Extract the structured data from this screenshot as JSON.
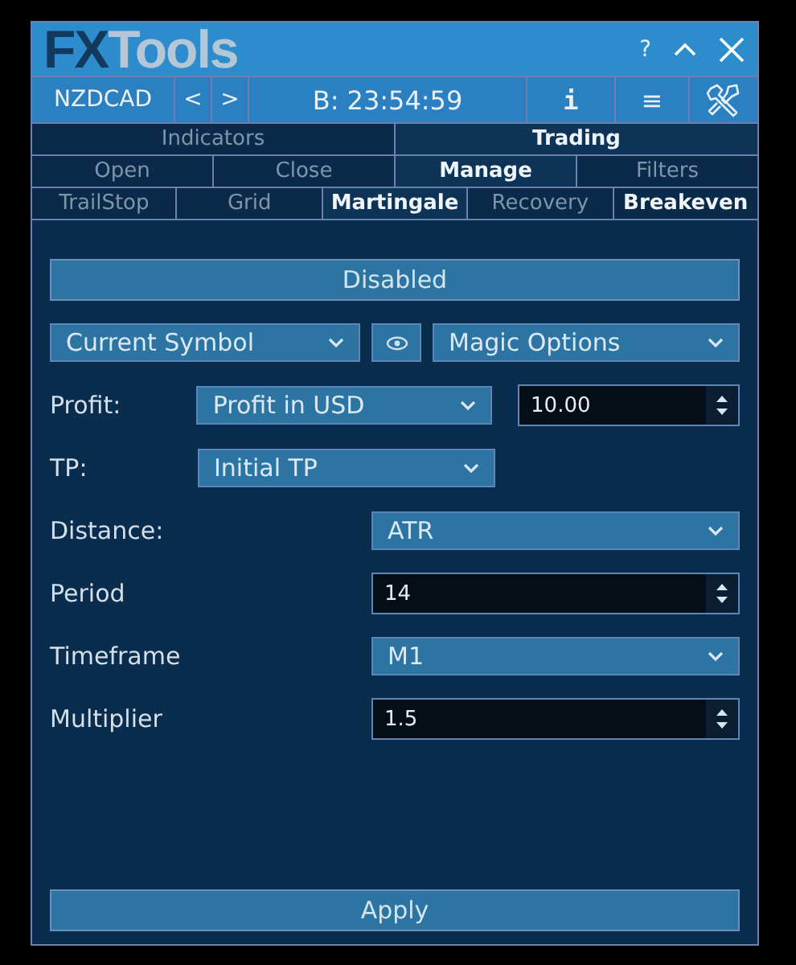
{
  "window": {
    "logo": {
      "dark": "FX",
      "light": "Tools"
    },
    "help": "?"
  },
  "toolbar": {
    "symbol": "NZDCAD",
    "prev": "<",
    "next": ">",
    "timer": "B: 23:54:59",
    "info": "i",
    "menu": "≡"
  },
  "tab_rows": [
    [
      {
        "label": "Indicators",
        "selected": false,
        "bright": false
      },
      {
        "label": "Trading",
        "selected": true,
        "bright": true
      }
    ],
    [
      {
        "label": "Open",
        "selected": false,
        "bright": false
      },
      {
        "label": "Close",
        "selected": false,
        "bright": false
      },
      {
        "label": "Manage",
        "selected": true,
        "bright": true
      },
      {
        "label": "Filters",
        "selected": false,
        "bright": false
      }
    ],
    [
      {
        "label": "TrailStop",
        "selected": false,
        "bright": false
      },
      {
        "label": "Grid",
        "selected": false,
        "bright": false
      },
      {
        "label": "Martingale",
        "selected": true,
        "bright": true
      },
      {
        "label": "Recovery",
        "selected": false,
        "bright": false
      },
      {
        "label": "Breakeven",
        "selected": false,
        "bright": true
      }
    ]
  ],
  "status_button": "Disabled",
  "filters": {
    "symbol": "Current Symbol",
    "magic": "Magic Options"
  },
  "rows": [
    {
      "kind": "short-select-spin",
      "label": "Profit:",
      "value": "Profit in USD",
      "number": "10.00"
    },
    {
      "kind": "short-select",
      "label": "TP:",
      "value": "Initial TP"
    },
    {
      "kind": "select",
      "label": "Distance:",
      "value": "ATR"
    },
    {
      "kind": "spin",
      "label": "Period",
      "number": "14"
    },
    {
      "kind": "select",
      "label": "Timeframe",
      "value": "M1"
    },
    {
      "kind": "spin",
      "label": "Multiplier",
      "number": "1.5"
    }
  ],
  "apply_button": "Apply"
}
